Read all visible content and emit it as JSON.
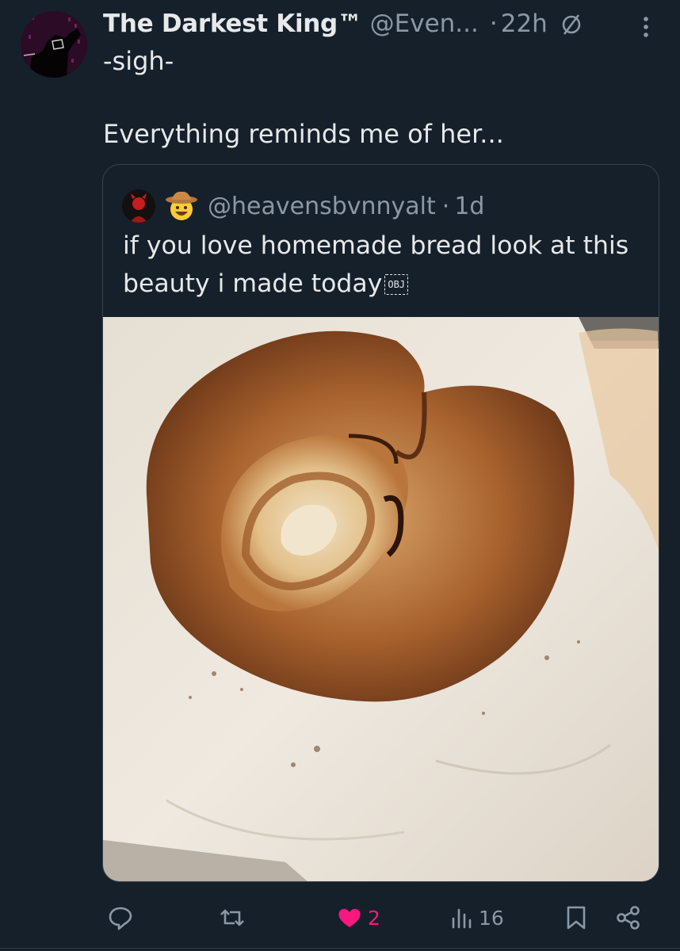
{
  "tweet": {
    "display_name": "The Darkest King™",
    "handle": "@Even...",
    "separator": "·",
    "time": "22h",
    "text_line_1": "-sigh-",
    "text_line_2": "Everything reminds me of her..."
  },
  "quote": {
    "handle": "@heavensbvnnyalt",
    "separator": "·",
    "time": "1d",
    "text": "if you love homemade bread look at this beauty i made today",
    "obj_glyph": "OBJ",
    "media_subject": "bread loaf on parchment paper"
  },
  "actions": {
    "reply_count": "",
    "retweet_count": "",
    "like_count": "2",
    "views_count": "16"
  },
  "colors": {
    "background": "#15202b",
    "text": "#e7e9ea",
    "secondary": "#8b98a5",
    "like": "#f91880"
  },
  "icons": [
    "muted-icon",
    "more-icon",
    "reply-icon",
    "retweet-icon",
    "heart-icon",
    "views-icon",
    "bookmark-icon",
    "share-icon"
  ]
}
